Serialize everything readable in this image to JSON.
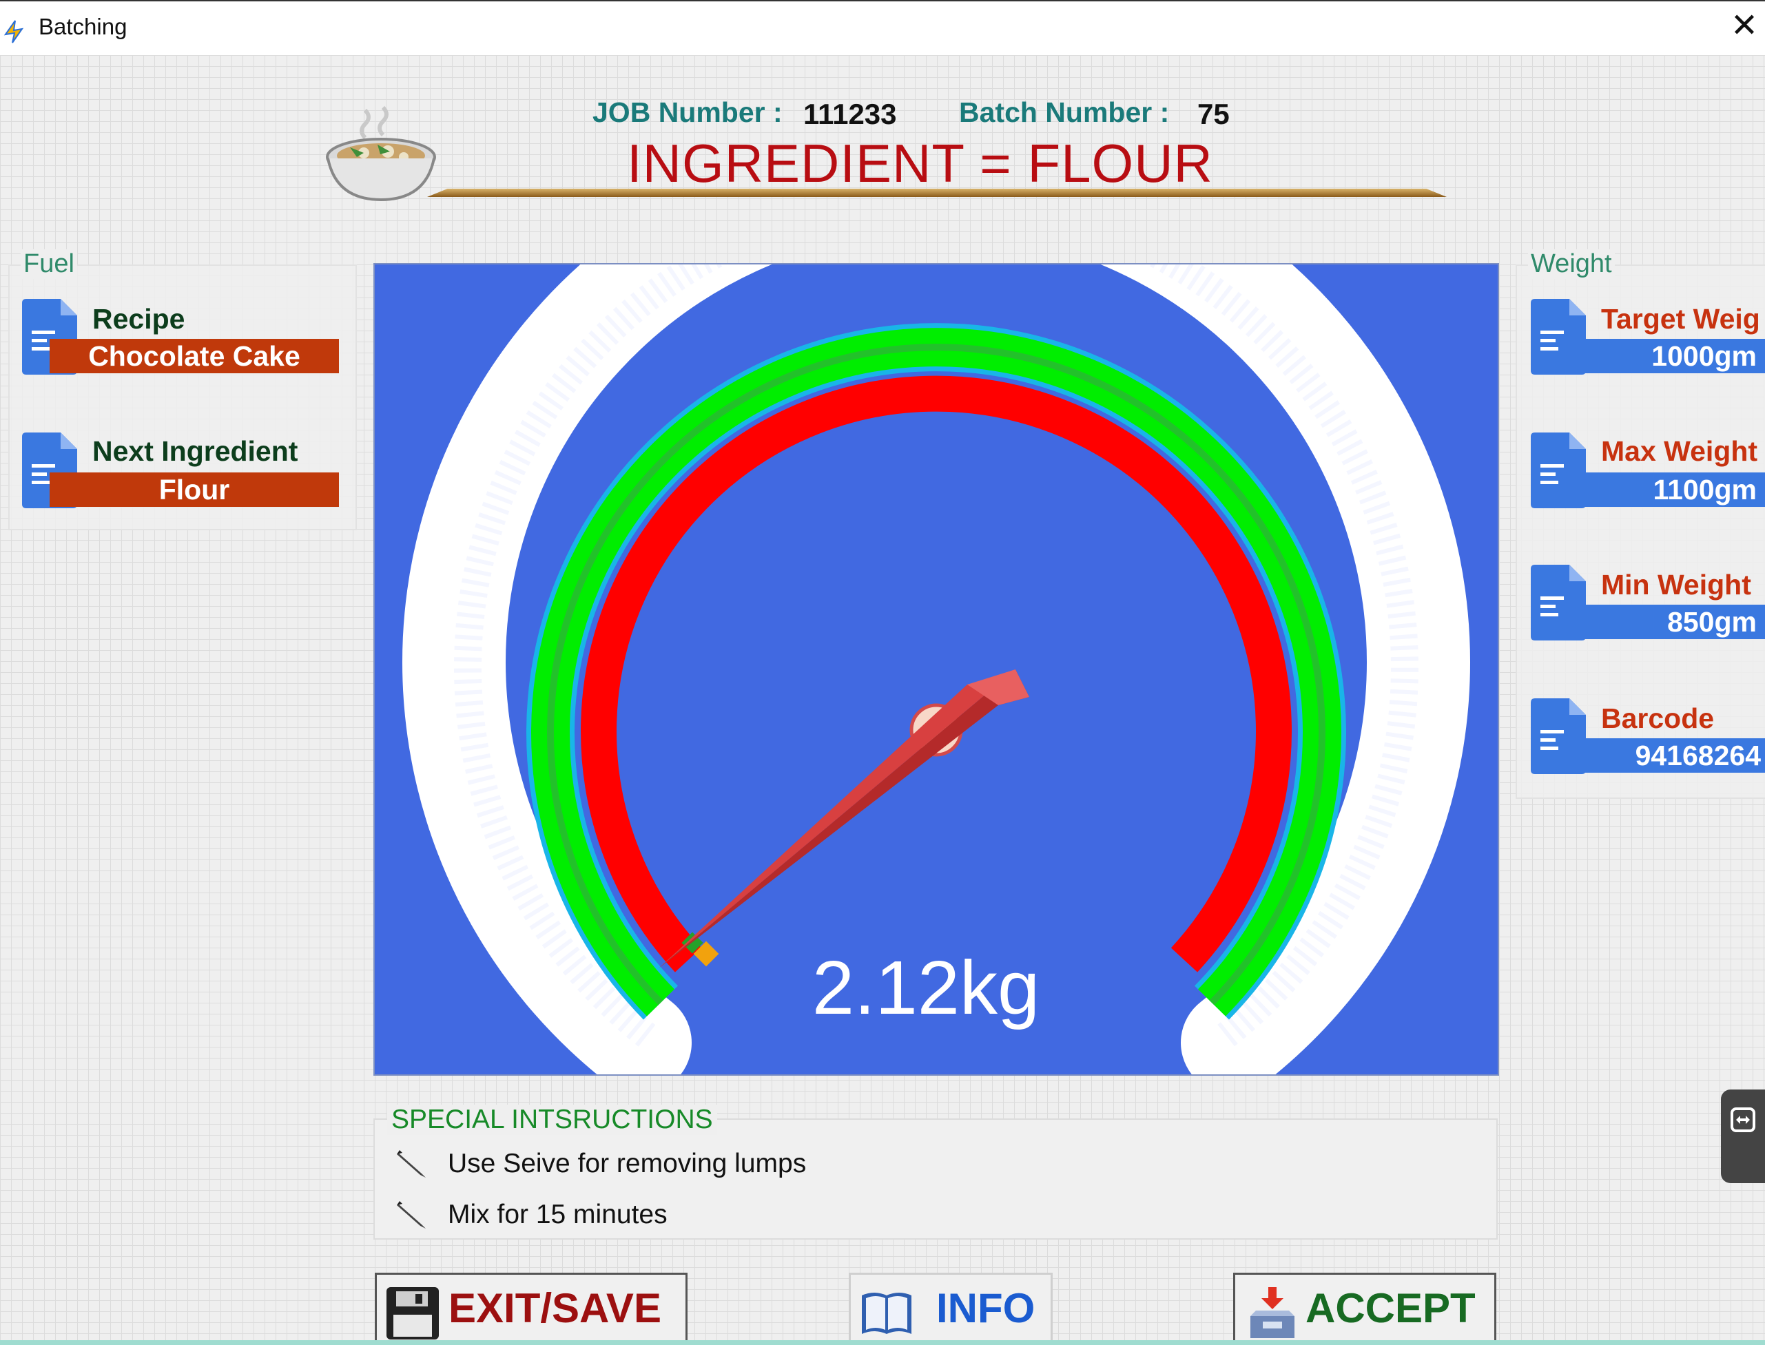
{
  "window": {
    "title": "Batching"
  },
  "header": {
    "job_label": "JOB Number :",
    "job_value": "111233",
    "batch_label": "Batch Number :",
    "batch_value": "75",
    "ingredient_title": "INGREDIENT = FLOUR"
  },
  "fuel_group": {
    "label": "Fuel",
    "recipe_label": "Recipe",
    "recipe_value": "Chocolate Cake",
    "next_label": "Next Ingredient",
    "next_value": "Flour"
  },
  "weight_group": {
    "label": "Weight",
    "target_label": "Target Weig",
    "target_value": "1000gm",
    "max_label": "Max Weight",
    "max_value": "1100gm",
    "min_label": "Min Weight",
    "min_value": "850gm",
    "barcode_label": "Barcode",
    "barcode_value": "94168264"
  },
  "gauge": {
    "reading": "2.12kg",
    "colors": {
      "background": "#4169e1",
      "red_band": "#ff0000",
      "green_band": "#00ee00",
      "needle": "#d84040"
    }
  },
  "instructions": {
    "title": "SPECIAL INTSRUCTIONS",
    "items": [
      "Use Seive for removing lumps",
      "Mix for 15 minutes"
    ]
  },
  "buttons": {
    "exit_save": "EXIT/SAVE",
    "info": "INFO",
    "accept": "ACCEPT"
  }
}
